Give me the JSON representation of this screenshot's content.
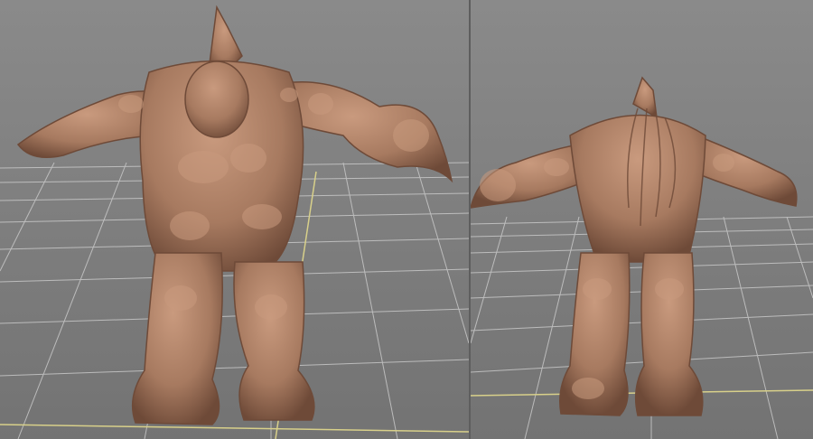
{
  "scene": {
    "background_color": "#7a7a7a",
    "grid_color": "#c8c8c8",
    "axis_color": "#d8d08a",
    "model_color": "#a77a60",
    "model_shadow_color": "#6e4a38",
    "model_highlight_color": "#c99a7e"
  },
  "views": {
    "front": {
      "subject": "creature-sculpt-front"
    },
    "back": {
      "subject": "creature-sculpt-back"
    }
  }
}
